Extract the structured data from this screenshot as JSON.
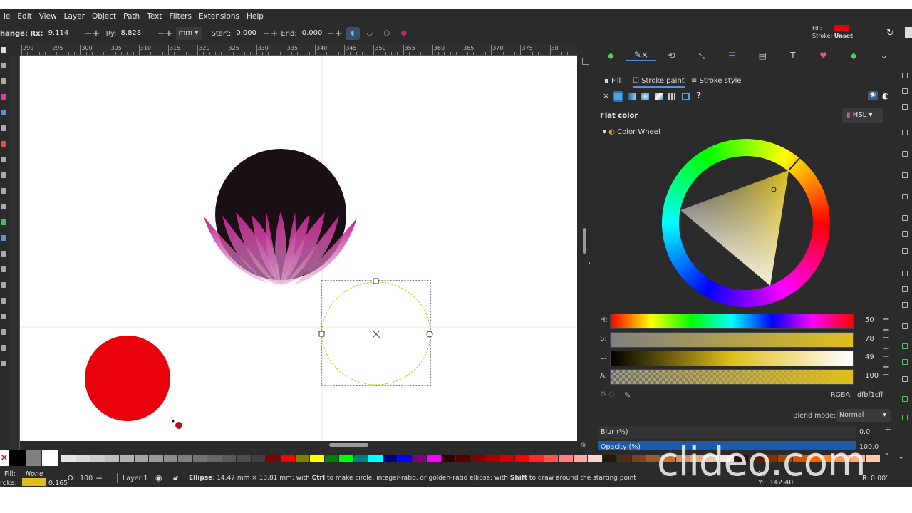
{
  "menu": [
    "le",
    "Edit",
    "View",
    "Layer",
    "Object",
    "Path",
    "Text",
    "Filters",
    "Extensions",
    "Help"
  ],
  "controls": {
    "change_label": "hange: Rx:",
    "rx": "9.114",
    "ry_label": "Ry:",
    "ry": "8.828",
    "unit": "mm",
    "start_label": "Start:",
    "start": "0.000",
    "end_label": "End:",
    "end": "0.000"
  },
  "topright": {
    "fill_label": "Fill:",
    "stroke_label": "Stroke:",
    "stroke_value": "Unset",
    "fill_color": "#e8000b"
  },
  "ruler_labels": [
    "290",
    "295",
    "300",
    "305",
    "310",
    "315",
    "320",
    "325",
    "330",
    "335",
    "340",
    "345",
    "350",
    "355",
    "360",
    "365",
    "370",
    "375",
    "38"
  ],
  "panel": {
    "subtabs": {
      "fill": "Fill",
      "stroke_paint": "Stroke paint",
      "stroke_style": "Stroke style"
    },
    "flat_color": "Flat color",
    "mode": "HSL",
    "color_wheel": "Color Wheel",
    "sliders": [
      {
        "label": "H:",
        "value": "50"
      },
      {
        "label": "S:",
        "value": "78"
      },
      {
        "label": "L:",
        "value": "49"
      },
      {
        "label": "A:",
        "value": "100"
      }
    ],
    "rgba_label": "RGBA:",
    "rgba": "dfbf1cff",
    "blend_label": "Blend mode:",
    "blend": "Normal",
    "blur_label": "Blur (%)",
    "blur": "0.0",
    "opacity_label": "Opacity (%)",
    "opacity": "100.0",
    "stroke_color": "#dfbf1c"
  },
  "status": {
    "fill_label": "Fill:",
    "fill_value": "None",
    "stroke_label": "roke:",
    "stroke_width": "0.165",
    "o_label": "O:",
    "o_value": "100",
    "layer": "Layer 1",
    "message_bold": "Ellipse",
    "message_1": ": 14.47 mm × 13.81 mm; with ",
    "ctrl": "Ctrl",
    "message_2": " to make circle, integer-ratio, or golden-ratio ellipse; with ",
    "shift": "Shift",
    "message_3": " to draw around the starting point",
    "x_label": "X:",
    "y_label": "Y:",
    "y_value": "142.40",
    "r_label": "R:",
    "r_value": "0.00°"
  },
  "watermark": "clideo.com"
}
